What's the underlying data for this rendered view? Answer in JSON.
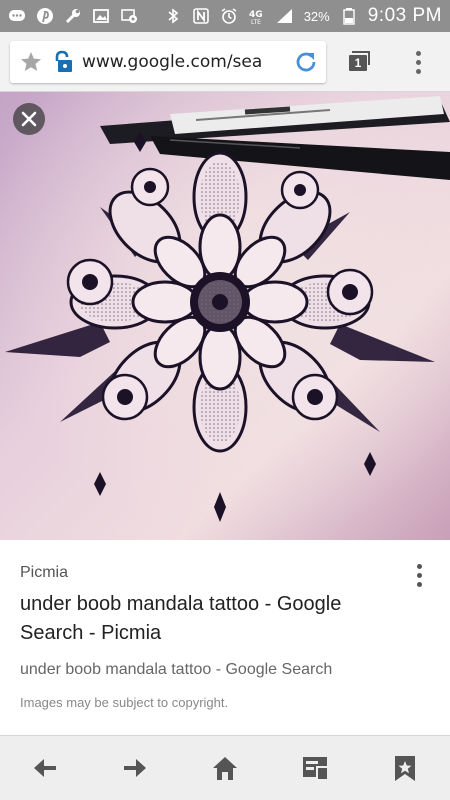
{
  "status_bar": {
    "battery_percent": "32%",
    "time": "9:03 PM",
    "network_label": "4G LTE",
    "icons": [
      "chat-bubble-icon",
      "pinterest-icon",
      "wrench-icon",
      "image-icon",
      "screen-cast-icon",
      "bluetooth-icon",
      "nfc-icon",
      "alarm-icon",
      "lte-icon",
      "signal-icon",
      "battery-icon"
    ]
  },
  "browser": {
    "url": "www.google.com/search?q=under+boob+mandala+tattoo",
    "url_visible": "www.google.com/sea",
    "tab_count": "1"
  },
  "image_viewer": {
    "source": "Picmia",
    "title": "under boob mandala tattoo - Google Search - Picmia",
    "subtitle": "under boob mandala tattoo - Google Search",
    "copyright_notice": "Images may be subject to copyright."
  },
  "bottom_nav": [
    "back-icon",
    "forward-icon",
    "home-icon",
    "reader-icon",
    "bookmark-icon"
  ],
  "colors": {
    "status_bar": "#8f8f8f",
    "toolbar": "#f2f2f2",
    "accent_reload": "#4a90d9"
  }
}
